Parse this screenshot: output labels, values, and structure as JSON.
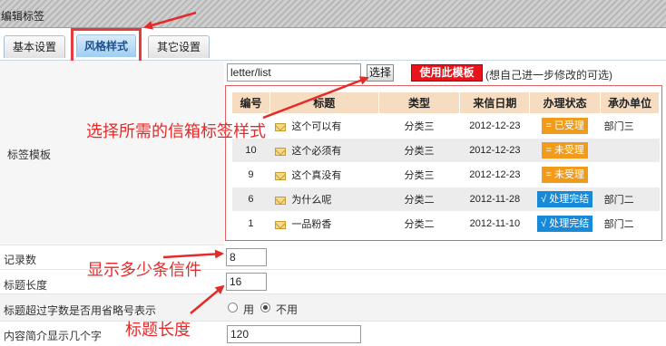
{
  "window": {
    "title": "编辑标签"
  },
  "tabs": [
    {
      "label": "基本设置"
    },
    {
      "label": "风格样式"
    },
    {
      "label": "其它设置"
    }
  ],
  "template": {
    "label": "标签模板",
    "input_value": "letter/list",
    "select_button": "选择",
    "use_button": "使用此模板",
    "hint": "(想自己进一步修改的可选)"
  },
  "preview": {
    "headers": [
      "编号",
      "标题",
      "类型",
      "来信日期",
      "办理状态",
      "承办单位"
    ],
    "rows": [
      {
        "id": "",
        "title": "这个可以有",
        "type": "分类三",
        "date": "2012-12-23",
        "status": "= 已受理",
        "dept": "部门三"
      },
      {
        "id": "10",
        "title": "这个必须有",
        "type": "分类三",
        "date": "2012-12-23",
        "status": "= 未受理",
        "dept": ""
      },
      {
        "id": "9",
        "title": "这个真没有",
        "type": "分类三",
        "date": "2012-12-23",
        "status": "= 未受理",
        "dept": ""
      },
      {
        "id": "6",
        "title": "为什么呢",
        "type": "分类二",
        "date": "2012-11-28",
        "status": "√ 处理完结",
        "dept": "部门二"
      },
      {
        "id": "1",
        "title": "一品粉香",
        "type": "分类二",
        "date": "2012-11-10",
        "status": "√ 处理完结",
        "dept": "部门二"
      }
    ]
  },
  "fields": {
    "record_count": {
      "label": "记录数",
      "value": "8"
    },
    "title_length": {
      "label": "标题长度",
      "value": "16"
    },
    "ellipsis": {
      "label": "标题超过字数是否用省略号表示",
      "option_yes": "用",
      "option_no": "不用"
    },
    "intro_length": {
      "label": "内容简介显示几个字",
      "value": "120"
    }
  },
  "annotations": {
    "choose_style": "选择所需的信箱标签样式",
    "show_count": "显示多少条信件",
    "title_length": "标题长度"
  },
  "colors": {
    "annotation": "#e62a2a",
    "use_button": "#e8141b",
    "status_pending": "#f19b1b",
    "status_done": "#1888d8",
    "table_header": "#f6dcc0"
  }
}
